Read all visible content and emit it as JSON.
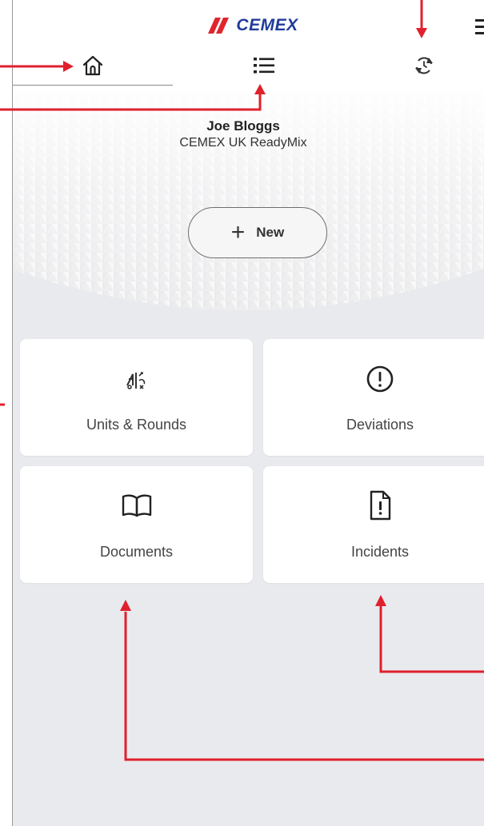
{
  "app": {
    "logo_text": "CEMEX"
  },
  "nav": {
    "tabs": [
      {
        "name": "home",
        "icon": "home-icon",
        "active": true
      },
      {
        "name": "list",
        "icon": "list-icon",
        "active": false
      },
      {
        "name": "history",
        "icon": "sync-history-icon",
        "active": false
      }
    ],
    "menu_icon": "hamburger-menu-icon"
  },
  "user": {
    "name": "Joe Bloggs",
    "organization": "CEMEX UK ReadyMix"
  },
  "actions": {
    "new_label": "New",
    "new_icon": "plus-icon"
  },
  "tiles": [
    {
      "label": "Units & Rounds",
      "icon": "units-rounds-icon"
    },
    {
      "label": "Deviations",
      "icon": "alert-circle-icon"
    },
    {
      "label": "Documents",
      "icon": "book-icon"
    },
    {
      "label": "Incidents",
      "icon": "incident-file-icon"
    }
  ],
  "colors": {
    "brand_blue": "#1f3b9b",
    "brand_red": "#e1252c",
    "annotation_red": "#e0202c",
    "background": "#e9eaee",
    "card": "#ffffff"
  }
}
